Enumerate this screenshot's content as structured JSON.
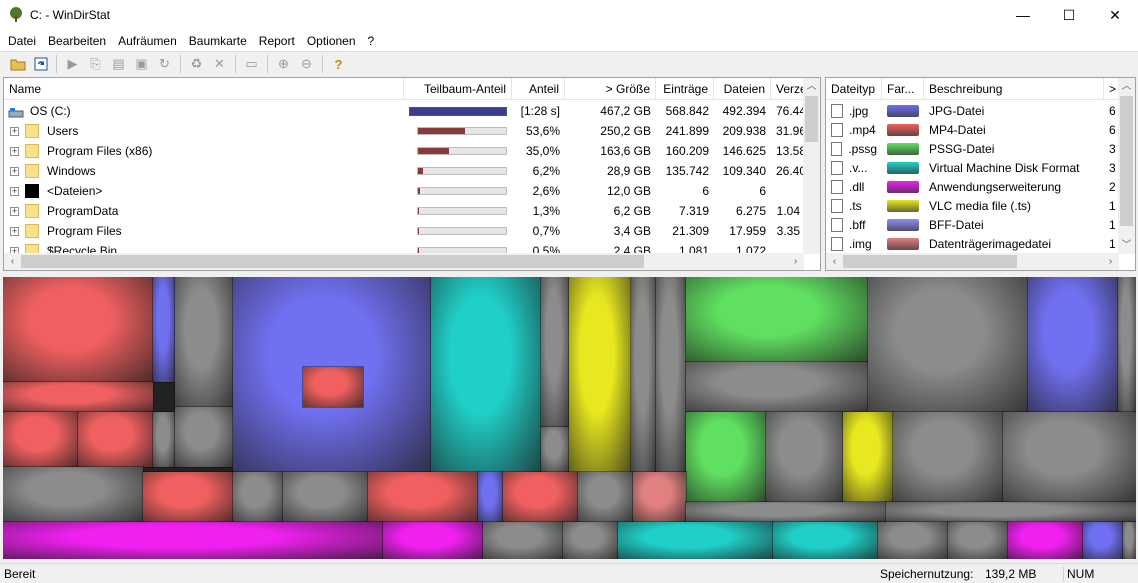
{
  "window": {
    "title": "C: - WinDirStat",
    "minimize_glyph": "—",
    "maximize_glyph": "☐",
    "close_glyph": "✕"
  },
  "menu": [
    "Datei",
    "Bearbeiten",
    "Aufräumen",
    "Baumkarte",
    "Report",
    "Optionen",
    "?"
  ],
  "toolbar": {
    "icons": [
      "open-icon",
      "refresh-icon",
      "run-icon",
      "copy-path-icon",
      "explorer-icon",
      "command-prompt-icon",
      "refresh-selected-icon",
      "recycle-icon",
      "delete-icon",
      "properties-icon",
      "zoom-in-icon",
      "zoom-out-icon",
      "help-icon"
    ]
  },
  "tree": {
    "columns": [
      "Name",
      "Teilbaum-Anteil",
      "Anteil",
      "> Größe",
      "Einträge",
      "Dateien",
      "Verzei"
    ],
    "rows": [
      {
        "name": "OS (C:)",
        "percent": "[1:28 s]",
        "fill": 1.0,
        "size": "467,2 GB",
        "items": "568.842",
        "files": "492.394",
        "dirs": "76.44",
        "kind": "drive"
      },
      {
        "name": "Users",
        "percent": "53,6%",
        "fill": 0.536,
        "size": "250,2 GB",
        "items": "241.899",
        "files": "209.938",
        "dirs": "31.96",
        "kind": "folder"
      },
      {
        "name": "Program Files (x86)",
        "percent": "35,0%",
        "fill": 0.35,
        "size": "163,6 GB",
        "items": "160.209",
        "files": "146.625",
        "dirs": "13.58",
        "kind": "folder"
      },
      {
        "name": "Windows",
        "percent": "6,2%",
        "fill": 0.062,
        "size": "28,9 GB",
        "items": "135.742",
        "files": "109.340",
        "dirs": "26.40",
        "kind": "folder"
      },
      {
        "name": "<Dateien>",
        "percent": "2,6%",
        "fill": 0.026,
        "size": "12,0 GB",
        "items": "6",
        "files": "6",
        "dirs": "",
        "kind": "files"
      },
      {
        "name": "ProgramData",
        "percent": "1,3%",
        "fill": 0.013,
        "size": "6,2 GB",
        "items": "7.319",
        "files": "6.275",
        "dirs": "1.04",
        "kind": "folder"
      },
      {
        "name": "Program Files",
        "percent": "0,7%",
        "fill": 0.007,
        "size": "3,4 GB",
        "items": "21.309",
        "files": "17.959",
        "dirs": "3.35",
        "kind": "folder"
      },
      {
        "name": "$Recycle.Bin",
        "percent": "0,5%",
        "fill": 0.005,
        "size": "2,4 GB",
        "items": "1.081",
        "files": "1.072",
        "dirs": "",
        "kind": "folder"
      }
    ]
  },
  "extensions": {
    "columns": [
      "Dateityp",
      "Far...",
      "Beschreibung",
      ">"
    ],
    "rows": [
      {
        "ext": ".jpg",
        "color": "#7070f0",
        "desc": "JPG-Datei",
        "count": "6"
      },
      {
        "ext": ".mp4",
        "color": "#f06060",
        "desc": "MP4-Datei",
        "count": "6"
      },
      {
        "ext": ".pssg",
        "color": "#60e060",
        "desc": "PSSG-Datei",
        "count": "3"
      },
      {
        "ext": ".v...",
        "color": "#20d0c8",
        "desc": "Virtual Machine Disk Format",
        "count": "3"
      },
      {
        "ext": ".dll",
        "color": "#f020f0",
        "desc": "Anwendungserweiterung",
        "count": "2"
      },
      {
        "ext": ".ts",
        "color": "#e8e820",
        "desc": "VLC media file (.ts)",
        "count": "1"
      },
      {
        "ext": ".bff",
        "color": "#9090f0",
        "desc": "BFF-Datei",
        "count": "1"
      },
      {
        "ext": ".img",
        "color": "#e08080",
        "desc": "Datenträgerimagedatei",
        "count": "1"
      }
    ]
  },
  "status": {
    "left": "Bereit",
    "memory_label": "Speichernutzung:",
    "memory_value": "139,2 MB",
    "num": "NUM"
  }
}
